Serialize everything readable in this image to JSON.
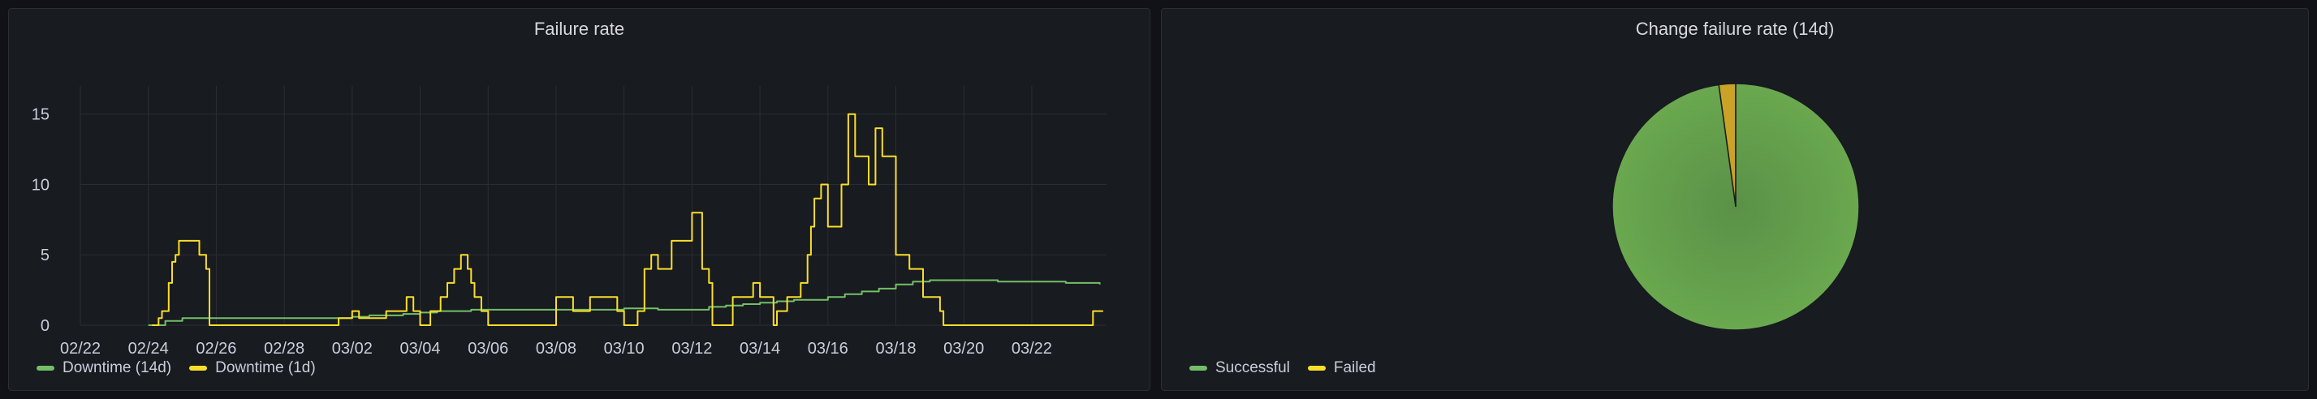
{
  "panels": {
    "left": {
      "title": "Failure rate"
    },
    "right": {
      "title": "Change failure rate (14d)"
    }
  },
  "colors": {
    "green": "#73bf69",
    "yellow": "#fade2a",
    "pie_green": "#6aa84f",
    "pie_yellow": "#c9a227",
    "grid": "#2a2d33",
    "text": "#ccccdc"
  },
  "legend_left": [
    {
      "label": "Downtime (14d)",
      "color": "#73bf69"
    },
    {
      "label": "Downtime (1d)",
      "color": "#fade2a"
    }
  ],
  "legend_right": [
    {
      "label": "Successful",
      "color": "#73bf69"
    },
    {
      "label": "Failed",
      "color": "#fade2a"
    }
  ],
  "chart_data": [
    {
      "type": "line",
      "title": "Failure rate",
      "x_unit": "days since 02/22",
      "xlim": [
        0,
        30.2
      ],
      "ylim": [
        0,
        17
      ],
      "x_tick_labels": [
        "02/22",
        "02/24",
        "02/26",
        "02/28",
        "03/02",
        "03/04",
        "03/06",
        "03/08",
        "03/10",
        "03/12",
        "03/14",
        "03/16",
        "03/18",
        "03/20",
        "03/22"
      ],
      "y_ticks": [
        0,
        5,
        10,
        15
      ],
      "series": [
        {
          "name": "Downtime (14d)",
          "color": "#73bf69",
          "x": [
            2.0,
            2.5,
            3.0,
            5.0,
            7.0,
            8.0,
            8.5,
            9.0,
            9.5,
            10.0,
            10.5,
            11.0,
            11.5,
            12.0,
            13.0,
            14.0,
            15.0,
            16.0,
            17.0,
            18.0,
            18.5,
            19.0,
            19.5,
            20.0,
            20.5,
            21.0,
            21.5,
            22.0,
            22.5,
            23.0,
            23.5,
            24.0,
            24.5,
            25.0,
            26.0,
            27.0,
            28.0,
            29.0,
            30.0
          ],
          "y": [
            0.0,
            0.3,
            0.5,
            0.5,
            0.5,
            0.6,
            0.7,
            0.7,
            0.8,
            0.9,
            1.0,
            1.0,
            1.1,
            1.1,
            1.1,
            1.1,
            1.1,
            1.2,
            1.1,
            1.1,
            1.3,
            1.4,
            1.5,
            1.6,
            1.7,
            1.8,
            1.8,
            2.0,
            2.2,
            2.4,
            2.6,
            2.9,
            3.1,
            3.2,
            3.2,
            3.1,
            3.1,
            3.0,
            2.9
          ]
        },
        {
          "name": "Downtime (1d)",
          "color": "#fade2a",
          "x": [
            2.1,
            2.3,
            2.4,
            2.6,
            2.7,
            2.8,
            2.9,
            3.4,
            3.5,
            3.7,
            3.8,
            4.0,
            7.5,
            7.6,
            8.0,
            8.2,
            9.0,
            9.6,
            9.8,
            10.0,
            10.3,
            10.6,
            10.8,
            11.0,
            11.2,
            11.4,
            11.5,
            11.6,
            11.8,
            12.0,
            12.5,
            14.0,
            14.5,
            15.0,
            15.8,
            16.0,
            16.4,
            16.6,
            16.8,
            17.0,
            17.4,
            18.0,
            18.3,
            18.5,
            18.6,
            19.2,
            19.8,
            20.0,
            20.4,
            20.5,
            20.8,
            21.0,
            21.2,
            21.4,
            21.5,
            21.6,
            21.8,
            22.0,
            22.4,
            22.6,
            22.8,
            23.2,
            23.4,
            23.6,
            24.0,
            24.4,
            24.8,
            25.3,
            25.4,
            25.6,
            26.0,
            26.4,
            26.7,
            26.9,
            27.0,
            27.3,
            27.5,
            28.0,
            28.5,
            29.0,
            29.7,
            29.8,
            30.1
          ],
          "y": [
            0.0,
            0.5,
            1.0,
            3.0,
            4.5,
            5.0,
            6.0,
            6.0,
            5.0,
            4.0,
            0.0,
            0.0,
            0.0,
            0.5,
            1.0,
            0.5,
            1.0,
            2.0,
            1.0,
            0.0,
            1.0,
            2.0,
            3.0,
            4.0,
            5.0,
            4.0,
            3.0,
            2.0,
            1.0,
            0.0,
            0.0,
            2.0,
            1.0,
            2.0,
            1.0,
            0.0,
            1.0,
            4.0,
            5.0,
            4.0,
            6.0,
            8.0,
            4.0,
            3.0,
            0.0,
            2.0,
            3.0,
            2.0,
            0.0,
            1.0,
            2.0,
            2.0,
            3.0,
            5.0,
            7.0,
            9.0,
            10.0,
            7.0,
            10.0,
            15.0,
            12.0,
            10.0,
            14.0,
            12.0,
            5.0,
            4.0,
            2.0,
            1.0,
            0.0,
            0.0,
            0.0,
            0.0,
            0.0,
            0.0,
            0.0,
            0.0,
            0.0,
            0.0,
            0.0,
            0.0,
            0.0,
            1.0,
            1.0
          ]
        }
      ]
    },
    {
      "type": "pie",
      "title": "Change failure rate (14d)",
      "labels": [
        "Successful",
        "Failed"
      ],
      "values": [
        97.8,
        2.2
      ],
      "colors": [
        "#6aa84f",
        "#c9a227"
      ]
    }
  ]
}
